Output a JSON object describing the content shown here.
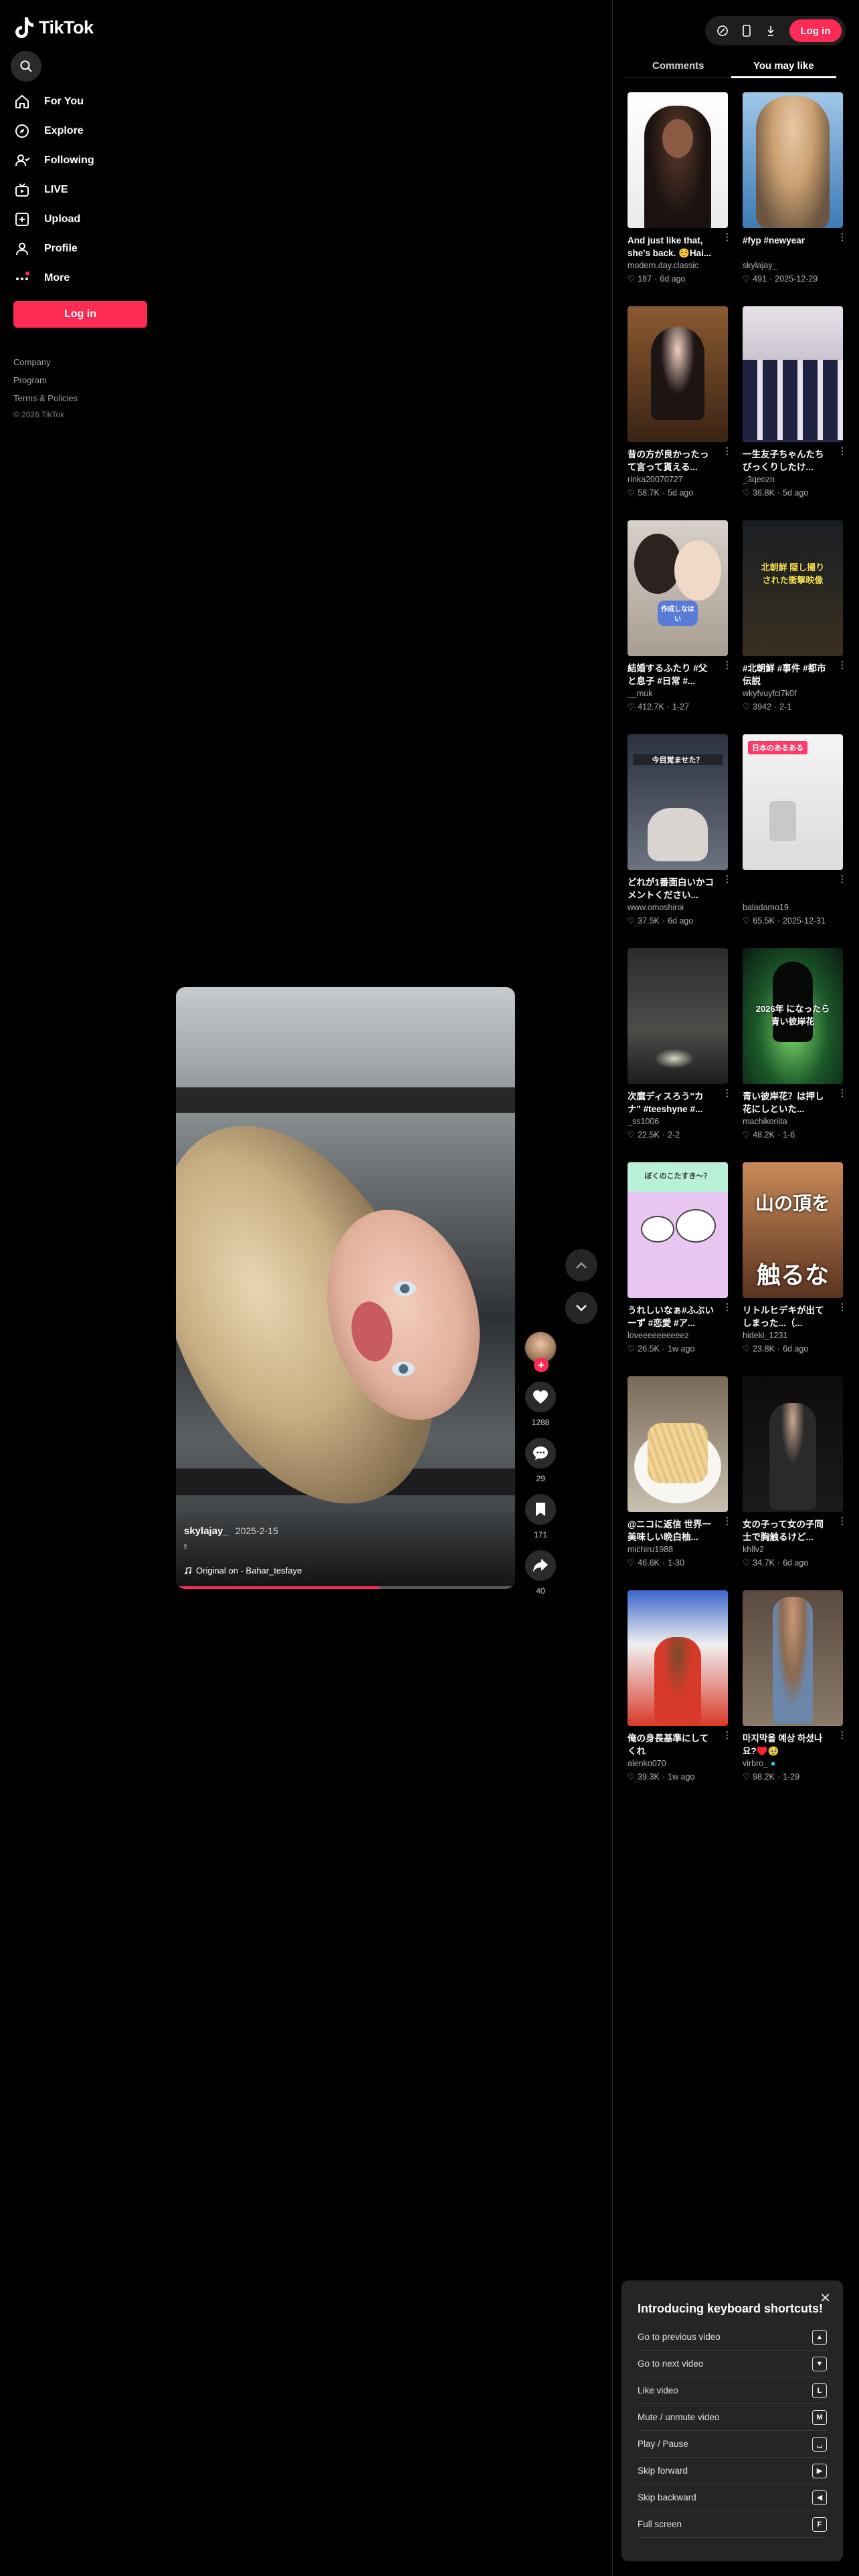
{
  "brand": {
    "name": "TikTok"
  },
  "sidebar": {
    "items": [
      {
        "label": "For You",
        "icon": "home-icon"
      },
      {
        "label": "Explore",
        "icon": "compass-icon"
      },
      {
        "label": "Following",
        "icon": "following-icon"
      },
      {
        "label": "LIVE",
        "icon": "live-icon"
      },
      {
        "label": "Upload",
        "icon": "upload-icon"
      },
      {
        "label": "Profile",
        "icon": "profile-icon"
      },
      {
        "label": "More",
        "icon": "more-icon"
      }
    ],
    "login_label": "Log in",
    "footer": {
      "company": "Company",
      "program": "Program",
      "terms": "Terms & Policies",
      "copyright": "© 2026 TikTok"
    }
  },
  "video": {
    "author": "skylajay_",
    "date": "2025-2-15",
    "caption": "ᵎᵎ",
    "music": "Original on - Bahar_tesfaye",
    "progress": 0.6,
    "likes": "1288",
    "comments": "29",
    "saves": "171",
    "shares": "40"
  },
  "topbar": {
    "login_label": "Log in"
  },
  "tabs": [
    {
      "label": "Comments"
    },
    {
      "label": "You may like"
    }
  ],
  "recommendations": [
    {
      "title": "And just like that, she's back. ☺️Hai...",
      "author": "modern.day.classic",
      "likes": "187",
      "age": "6d ago"
    },
    {
      "title": "#fyp #newyear",
      "author": "skylajay_",
      "likes": "491",
      "age": "2025-12-29"
    },
    {
      "title": "昔の方が良かったって言って貰える...",
      "author": "rinka20070727",
      "likes": "58.7K",
      "age": "5d ago"
    },
    {
      "title": "一生友子ちゃんたちびっくりしたけ...",
      "author": "_3qeozn",
      "likes": "36.8K",
      "age": "5d ago"
    },
    {
      "title": "結婚するふたり #父と息子 #日常 #...",
      "author": "__muk",
      "likes": "412.7K",
      "age": "1-27"
    },
    {
      "title": "#北朝鮮 #事件 #都市伝説",
      "author": "wkyfvuyfci7k0f",
      "likes": "3942",
      "age": "2-1"
    },
    {
      "title": "どれが1番面白いかコメントください...",
      "author": "www.omoshiroi",
      "likes": "37.5K",
      "age": "6d ago"
    },
    {
      "title": "",
      "author": "baladamo19",
      "likes": "65.5K",
      "age": "2025-12-31"
    },
    {
      "title": "次麿ディスろう\"カナ\" #teeshyne #...",
      "author": "_ss1006",
      "likes": "22.5K",
      "age": "2-2"
    },
    {
      "title": "青い彼岸花？は押し花にしといた...",
      "author": "machikoriita",
      "likes": "48.2K",
      "age": "1-6"
    },
    {
      "title": "うれしいなぁ#ふぶいーず #恋愛 #ア...",
      "author": "loveeeeeeeeeez",
      "likes": "26.5K",
      "age": "1w ago"
    },
    {
      "title": "リトルヒデキが出てしまった...（...",
      "author": "hideki_1231",
      "likes": "23.8K",
      "age": "6d ago"
    },
    {
      "title": "@ニコに返信 世界一美味しい晩白柚...",
      "author": "michiru1988",
      "likes": "46.6K",
      "age": "1-30"
    },
    {
      "title": "女の子って女の子同士で胸触るけど...",
      "author": "khllv2",
      "likes": "34.7K",
      "age": "6d ago"
    },
    {
      "title": "俺の身長基準にしてくれ",
      "author": "alenko070",
      "likes": "39.3K",
      "age": "1w ago"
    },
    {
      "title": "마지막을 예상 하셨나요?♥️🥹",
      "author": "virbro_",
      "likes": "98.2K",
      "age": "1-29"
    }
  ],
  "thumb_texts": {
    "t3_label": "作成しなはい",
    "t6_label": "北朝鮮 隠し撮りされた衝撃映像",
    "t7_label": "今目覚ませた？",
    "t8_label": "日本のあるある",
    "t10_label": "2026年 になったら 青い彼岸花",
    "t11_label": "ぼくのこたすき～？",
    "t12_big": "山の頂を",
    "t12_sub": "触るな"
  },
  "shortcuts": {
    "title": "Introducing keyboard shortcuts!",
    "items": [
      {
        "label": "Go to previous video",
        "key": "▲"
      },
      {
        "label": "Go to next video",
        "key": "▼"
      },
      {
        "label": "Like video",
        "key": "L"
      },
      {
        "label": "Mute / unmute video",
        "key": "M"
      },
      {
        "label": "Play / Pause",
        "key": "␣"
      },
      {
        "label": "Skip forward",
        "key": "▶"
      },
      {
        "label": "Skip backward",
        "key": "◀"
      },
      {
        "label": "Full screen",
        "key": "F"
      }
    ]
  },
  "colors": {
    "accent": "#fe2c55",
    "background": "#000000",
    "panel": "#252525"
  }
}
